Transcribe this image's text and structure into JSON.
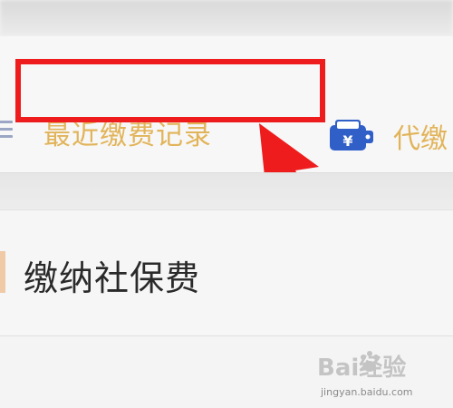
{
  "toolbar": {
    "recent_payments_label": "最近缴费记录",
    "proxy_label": "代缴"
  },
  "list": {
    "items": [
      {
        "label": "缴纳社保费"
      }
    ]
  },
  "watermark": {
    "brand_text": "Bai经验",
    "url": "jingyan.baidu.com"
  },
  "icons": {
    "menu": "menu-icon",
    "proxy": "yuan-wallet-icon",
    "annotation": "arrow-annotation-icon"
  },
  "colors": {
    "accent_gold": "#e2b45a",
    "highlight_red": "#ee1c1c",
    "proxy_blue": "#2f5fc7"
  }
}
